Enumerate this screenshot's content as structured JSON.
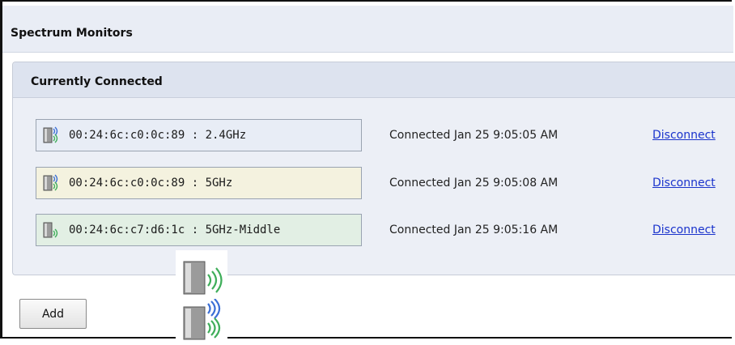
{
  "header": {
    "title": "Spectrum Monitors"
  },
  "panel": {
    "title": "Currently Connected"
  },
  "monitors": [
    {
      "label": "00:24:6c:c0:0c:89 : 2.4GHz",
      "status": "Connected Jan 25 9:05:05 AM",
      "action": "Disconnect",
      "color": "#e8edf6",
      "icon": "access-point-signal-icon"
    },
    {
      "label": "00:24:6c:c0:0c:89 : 5GHz",
      "status": "Connected Jan 25 9:05:08 AM",
      "action": "Disconnect",
      "color": "#f4f2df",
      "icon": "access-point-signal-icon"
    },
    {
      "label": "00:24:6c:c7:d6:1c : 5GHz-Middle",
      "status": "Connected Jan 25 9:05:16 AM",
      "action": "Disconnect",
      "color": "#e2efe4",
      "icon": "access-point-signal-icon"
    }
  ],
  "actions": {
    "add_label": "Add"
  },
  "colors": {
    "link": "#1a33cc",
    "signal_green": "#3fae5a",
    "signal_blue": "#3b6fd6"
  }
}
